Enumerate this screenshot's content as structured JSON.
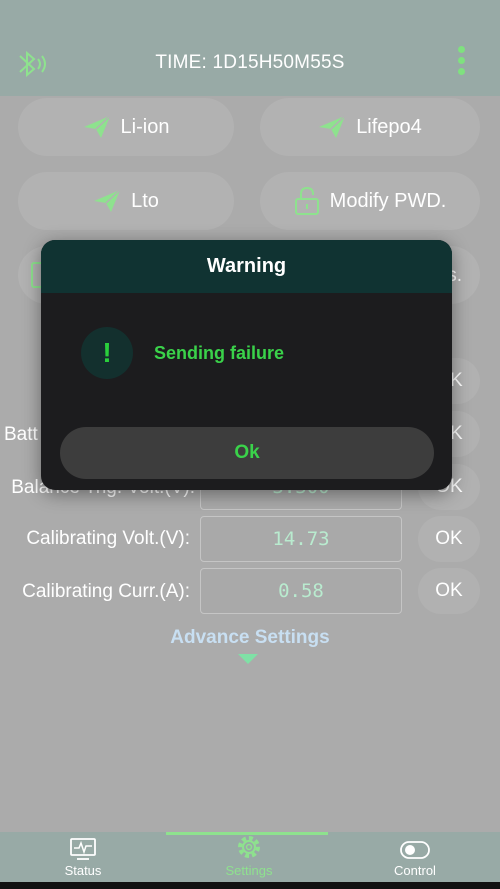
{
  "header": {
    "time": "TIME: 1D15H50M55S"
  },
  "battery_types": {
    "liion": "Li-ion",
    "lifepo4": "Lifepo4",
    "lto": "Lto",
    "modify_pwd": "Modify PWD.",
    "row3_right_partial": "s."
  },
  "settings": {
    "rows": [
      {
        "label": "Batt",
        "value": "",
        "ok": "OK"
      },
      {
        "label": "Balance Trig. Volt.(V):",
        "value": "3.300",
        "ok": "OK"
      },
      {
        "label": "Calibrating Volt.(V):",
        "value": "14.73",
        "ok": "OK"
      },
      {
        "label": "Calibrating Curr.(A):",
        "value": "0.58",
        "ok": "OK"
      }
    ],
    "top_ok": "OK",
    "advance_label": "Advance Settings"
  },
  "tabs": [
    {
      "label": "Status"
    },
    {
      "label": "Settings"
    },
    {
      "label": "Control"
    }
  ],
  "dialog": {
    "title": "Warning",
    "icon_glyph": "!",
    "message": "Sending failure",
    "ok_label": "Ok"
  },
  "colors": {
    "accent_green": "#3ad24a",
    "dialog_header": "#103332",
    "overlay_gray": "#ababab"
  }
}
